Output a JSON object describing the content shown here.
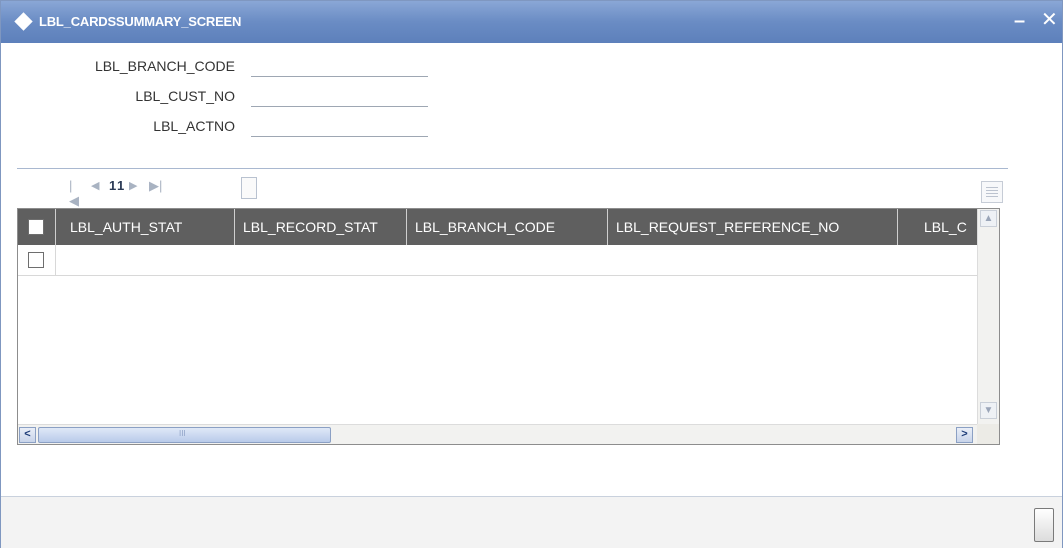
{
  "window": {
    "title": "LBL_CARDSSUMMARY_SCREEN",
    "minimize_symbol": "–",
    "close_symbol": "✕"
  },
  "form": {
    "fields": [
      {
        "label": "LBL_BRANCH_CODE",
        "value": ""
      },
      {
        "label": "LBL_CUST_NO",
        "value": ""
      },
      {
        "label": "LBL_ACTNO",
        "value": ""
      }
    ]
  },
  "pager": {
    "first_symbol": "|◀",
    "prev_symbol": "◀",
    "current_page": "1",
    "total_pages": "1",
    "next_symbol": "▶",
    "last_symbol": "▶|"
  },
  "grid": {
    "columns": [
      "LBL_AUTH_STAT",
      "LBL_RECORD_STAT",
      "LBL_BRANCH_CODE",
      "LBL_REQUEST_REFERENCE_NO",
      "LBL_C"
    ],
    "rows": [
      {
        "selected": false
      }
    ],
    "scroll_up_symbol": "▲",
    "scroll_down_symbol": "▼",
    "scroll_left_symbol": "<",
    "scroll_right_symbol": ">",
    "scroll_grip": "III"
  },
  "icons": {
    "window_icon": "diamond-icon",
    "column_options": "grid-options-icon"
  },
  "colors": {
    "titlebar": "#6a8cc4",
    "header": "#5f5f5f",
    "label_text": "#333333"
  }
}
